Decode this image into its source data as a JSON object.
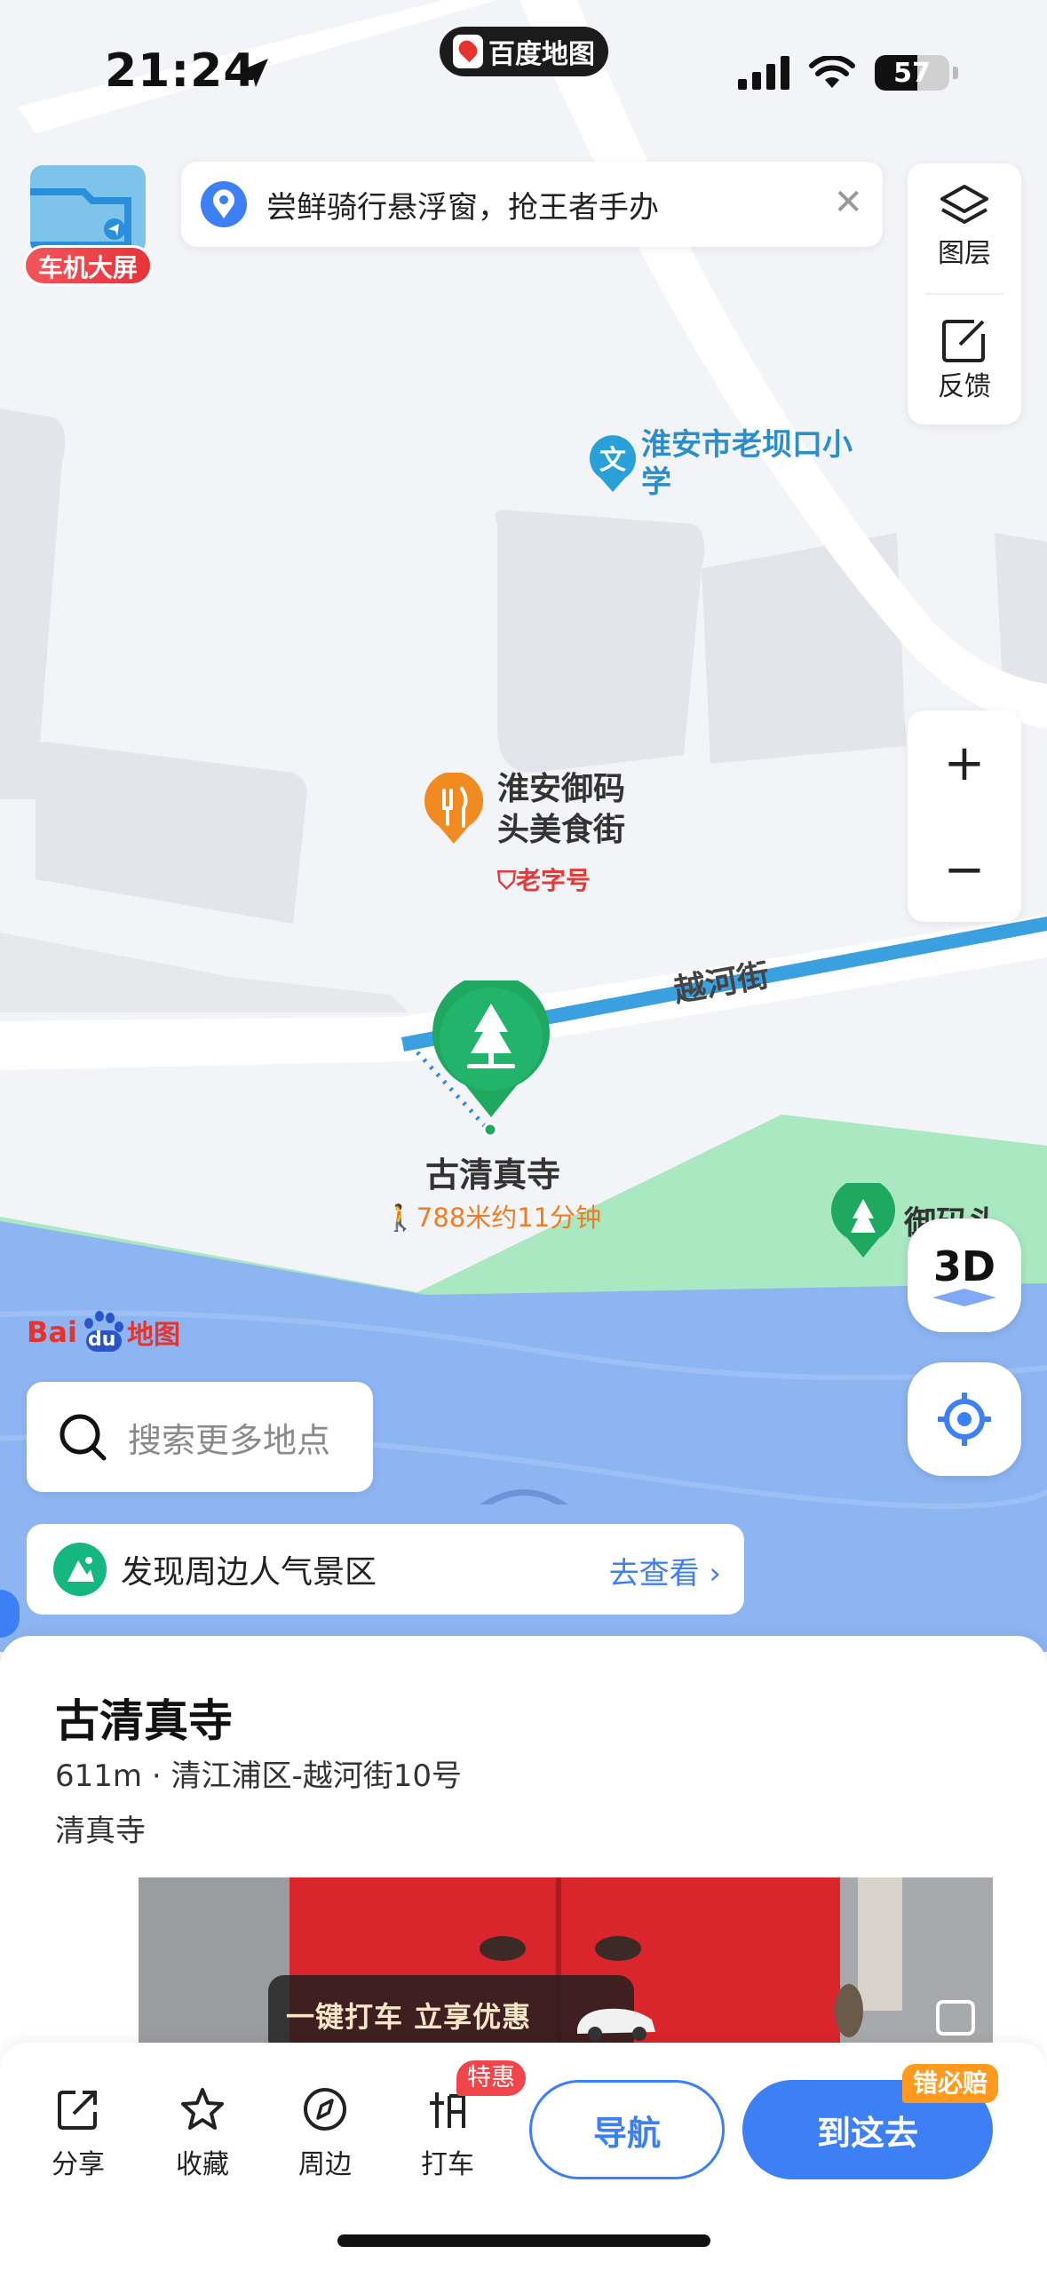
{
  "status_bar": {
    "time": "21:24",
    "app_name": "百度地图",
    "battery": "57",
    "battery_level": 0.57
  },
  "car_screen": {
    "label": "车机大屏"
  },
  "banner": {
    "text": "尝鲜骑行悬浮窗，抢王者手办",
    "close": "✕"
  },
  "tools": [
    {
      "icon": "layers-icon",
      "label": "图层"
    },
    {
      "icon": "feedback-icon",
      "label": "反馈"
    }
  ],
  "zoom": {
    "in": "+",
    "out": "−"
  },
  "map_labels": {
    "school": "淮安市老坝口小学",
    "food_street_line1": "淮安御码",
    "food_street_line2": "头美食街",
    "food_badge": "老字号",
    "street": "越河街",
    "mosque": "古清真寺",
    "walk": "788米约11分钟",
    "partial_poi": "御码头"
  },
  "btn3d": "3D",
  "logo": {
    "bai": "Bai",
    "du": "du",
    "map": "地图"
  },
  "search_more": {
    "placeholder": "搜索更多地点"
  },
  "discover": {
    "text": "发现周边人气景区",
    "link": "去查看 ›"
  },
  "place": {
    "title": "古清真寺",
    "meta": "611m · 清江浦区-越河街10号",
    "category": "清真寺"
  },
  "promo": {
    "text": "一键打车 立享优惠"
  },
  "actions": [
    {
      "icon": "share-icon",
      "label": "分享"
    },
    {
      "icon": "star-icon",
      "label": "收藏"
    },
    {
      "icon": "compass-icon",
      "label": "周边"
    },
    {
      "icon": "taxi-icon",
      "label": "打车"
    }
  ],
  "taxi_badge": "特惠",
  "nav_button": "导航",
  "go_button": "到这去",
  "guarantee_badge": "错必赔",
  "colors": {
    "accent": "#3d7ff5",
    "poi_green": "#1fa860",
    "water": "#8db5f2",
    "park": "#a9e8c1"
  }
}
